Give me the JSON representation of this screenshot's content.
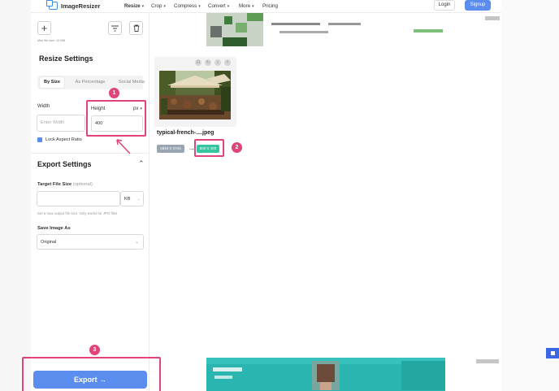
{
  "brand": {
    "name": "ImageResizer"
  },
  "nav": {
    "items": [
      {
        "label": "Resize",
        "has_caret": true,
        "active": true
      },
      {
        "label": "Crop",
        "has_caret": true
      },
      {
        "label": "Compress",
        "has_caret": true
      },
      {
        "label": "Convert",
        "has_caret": true
      },
      {
        "label": "More",
        "has_caret": true
      },
      {
        "label": "Pricing",
        "has_caret": false
      }
    ],
    "login": "Login",
    "signup": "Signup"
  },
  "sidebar": {
    "max_file_size": "Max file size: 10 MB",
    "resize_title": "Resize Settings",
    "tabs": [
      "By Size",
      "As Percentage",
      "Social Media"
    ],
    "width_label": "Width",
    "width_placeholder": "Enter Width",
    "height_label": "Height",
    "height_value": "400",
    "unit": "px",
    "lock_label": "Lock Aspect Ratio",
    "lock_checked": true,
    "export_title": "Export Settings",
    "target_label": "Target File Size",
    "target_optional": "(optional)",
    "target_unit": "KB",
    "target_hint": "Set a max output file size. Only works for JPG files",
    "save_as_label": "Save Image As",
    "save_as_value": "Original",
    "export_button": "Export →"
  },
  "image": {
    "filename": "typical-french-....jpeg",
    "original_dims": "5616 X 3744",
    "new_dims": "600 X 400"
  },
  "annotations": [
    "1",
    "2",
    "3"
  ],
  "colors": {
    "accent": "#5b8def",
    "highlight": "#e0447a",
    "new_dims": "#37c4a0"
  }
}
